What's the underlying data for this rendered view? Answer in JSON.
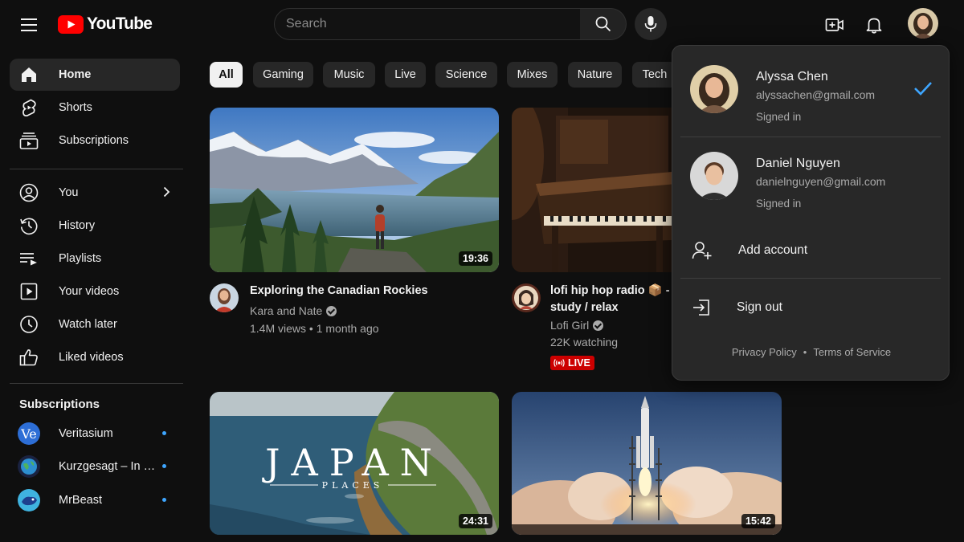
{
  "header": {
    "logo_text": "YouTube",
    "search_placeholder": "Search"
  },
  "sidebar": {
    "main": [
      {
        "label": "Home",
        "icon": "home-icon"
      },
      {
        "label": "Shorts",
        "icon": "shorts-icon"
      },
      {
        "label": "Subscriptions",
        "icon": "subscriptions-icon"
      }
    ],
    "you": [
      {
        "label": "You",
        "icon": "user-icon"
      },
      {
        "label": "History",
        "icon": "history-icon"
      },
      {
        "label": "Playlists",
        "icon": "playlist-icon"
      },
      {
        "label": "Your videos",
        "icon": "video-icon"
      },
      {
        "label": "Watch later",
        "icon": "clock-icon"
      },
      {
        "label": "Liked videos",
        "icon": "thumbs-up-icon"
      }
    ],
    "subscriptions_heading": "Subscriptions",
    "subscriptions": [
      {
        "label": "Veritasium",
        "avatar_text": "Ve"
      },
      {
        "label": "Kurzgesagt – In a Nutshell"
      },
      {
        "label": "MrBeast"
      }
    ]
  },
  "chips": [
    "All",
    "Gaming",
    "Music",
    "Live",
    "Science",
    "Mixes",
    "Nature",
    "Tech"
  ],
  "videos": [
    {
      "title": "Exploring the Canadian Rockies",
      "channel": "Kara and Nate",
      "meta": "1.4M views • 1 month ago",
      "duration": "19:36"
    },
    {
      "title_line1": "lofi hip hop radio 📦 - bea",
      "title_line2": "study / relax",
      "channel": "Lofi Girl",
      "meta": "22K watching",
      "badge": "LIVE"
    },
    {
      "overlay_title": "JAPAN",
      "overlay_subtitle": "PLACES",
      "duration": "24:31"
    },
    {
      "duration": "15:42"
    }
  ],
  "account_menu": {
    "accounts": [
      {
        "name": "Alyssa Chen",
        "email": "alyssachen@gmail.com",
        "status": "Signed in",
        "selected": true
      },
      {
        "name": "Daniel Nguyen",
        "email": "danielnguyen@gmail.com",
        "status": "Signed in",
        "selected": false
      }
    ],
    "add_account": "Add account",
    "sign_out": "Sign out",
    "footer_privacy": "Privacy Policy",
    "footer_sep": "•",
    "footer_terms": "Terms of Service"
  },
  "colors": {
    "background": "#0f0f0f",
    "brand_red": "#ff0000",
    "accent_blue": "#3ea6ff",
    "live_red": "#cc0000"
  }
}
